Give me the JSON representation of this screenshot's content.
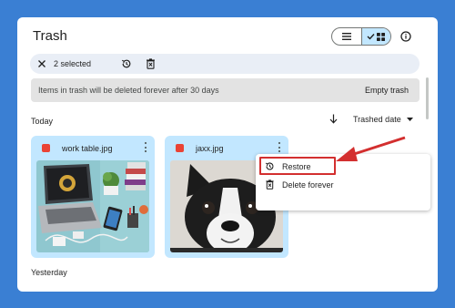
{
  "header": {
    "title": "Trash"
  },
  "selection_bar": {
    "count_label": "2 selected"
  },
  "banner": {
    "message": "Items in trash will be deleted forever after 30 days",
    "action": "Empty trash"
  },
  "sections": {
    "today": "Today",
    "yesterday": "Yesterday"
  },
  "sort": {
    "label": "Trashed date"
  },
  "files": [
    {
      "name": "work table.jpg"
    },
    {
      "name": "jaxx.jpg"
    }
  ],
  "context_menu": {
    "items": [
      {
        "label": "Restore",
        "icon": "restore-icon"
      },
      {
        "label": "Delete forever",
        "icon": "delete-forever-icon"
      }
    ]
  },
  "colors": {
    "background": "#3a7fd3",
    "selected_card": "#c2e7ff",
    "annotation": "#d32f2f"
  }
}
